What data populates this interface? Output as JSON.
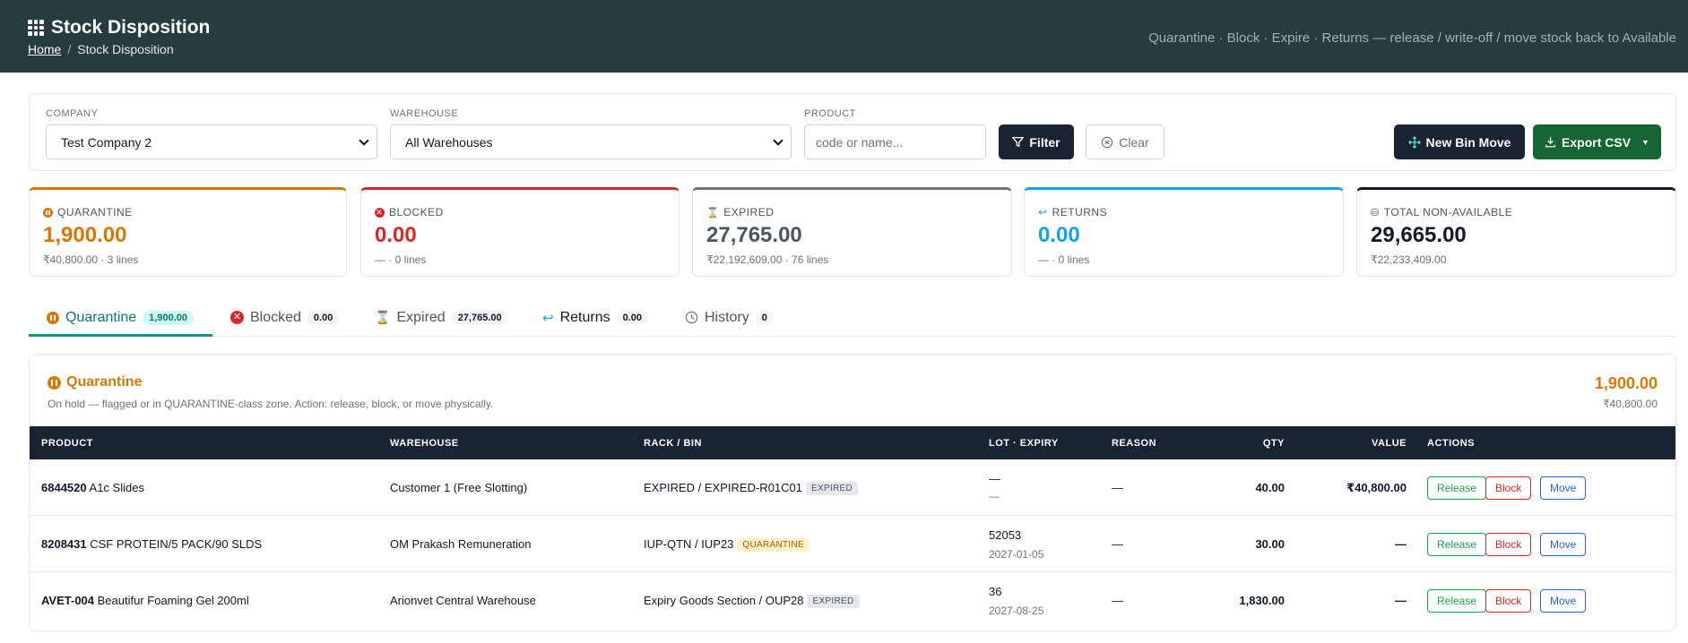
{
  "header": {
    "title": "Stock Disposition",
    "breadcrumb_home": "Home",
    "breadcrumb_sep": "/",
    "breadcrumb_current": "Stock Disposition",
    "subtitle": "Quarantine · Block · Expire · Returns — release / write-off / move stock back to Available"
  },
  "filters": {
    "company_label": "COMPANY",
    "company_value": "Test Company 2",
    "warehouse_label": "WAREHOUSE",
    "warehouse_value": "All Warehouses",
    "product_label": "PRODUCT",
    "product_placeholder": "code or name...",
    "filter_btn": "Filter",
    "clear_btn": "Clear",
    "new_bin_move_btn": "New Bin Move",
    "export_btn": "Export CSV"
  },
  "cards": [
    {
      "label": "QUARANTINE",
      "value": "1,900.00",
      "sub": "₹40,800.00 · 3 lines",
      "color": "#d97706"
    },
    {
      "label": "BLOCKED",
      "value": "0.00",
      "sub": "— · 0 lines",
      "color": "#dc2626"
    },
    {
      "label": "EXPIRED",
      "value": "27,765.00",
      "sub": "₹22,192,609.00 · 76 lines",
      "color": "#4b5563"
    },
    {
      "label": "RETURNS",
      "value": "0.00",
      "sub": "— · 0 lines",
      "color": "#0ea5e9"
    },
    {
      "label": "TOTAL NON-AVAILABLE",
      "value": "29,665.00",
      "sub": "₹22,233,409.00",
      "color": "#111827"
    }
  ],
  "tabs": [
    {
      "label": "Quarantine",
      "count": "1,900.00"
    },
    {
      "label": "Blocked",
      "count": "0.00"
    },
    {
      "label": "Expired",
      "count": "27,765.00"
    },
    {
      "label": "Returns",
      "count": "0.00"
    },
    {
      "label": "History",
      "count": "0"
    }
  ],
  "panel": {
    "title": "Quarantine",
    "description": "On hold — flagged or in QUARANTINE-class zone. Action: release, block, or move physically.",
    "total": "1,900.00",
    "total_value": "₹40,800.00"
  },
  "table": {
    "columns": [
      "PRODUCT",
      "WAREHOUSE",
      "RACK / BIN",
      "LOT · EXPIRY",
      "REASON",
      "QTY",
      "VALUE",
      "ACTIONS"
    ],
    "rows": [
      {
        "code": "6844520",
        "name": "A1c Slides",
        "warehouse": "Customer 1 (Free Slotting)",
        "bin": "EXPIRED / EXPIRED-R01C01",
        "tag": "EXPIRED",
        "lot": "—",
        "expiry": "—",
        "reason": "—",
        "qty": "40.00",
        "value": "₹40,800.00"
      },
      {
        "code": "8208431",
        "name": "CSF PROTEIN/5 PACK/90 SLDS",
        "warehouse": "OM Prakash Remuneration",
        "bin": "IUP-QTN / IUP23",
        "tag": "QUARANTINE",
        "lot": "52053",
        "expiry": "2027-01-05",
        "reason": "—",
        "qty": "30.00",
        "value": "—"
      },
      {
        "code": "AVET-004",
        "name": "Beautifur Foaming Gel 200ml",
        "warehouse": "Arionvet Central Warehouse",
        "bin": "Expiry Goods Section / OUP28",
        "tag": "EXPIRED",
        "lot": "36",
        "expiry": "2027-08-25",
        "reason": "—",
        "qty": "1,830.00",
        "value": "—"
      }
    ],
    "actions": {
      "release": "Release",
      "block": "Block",
      "move": "Move"
    }
  }
}
